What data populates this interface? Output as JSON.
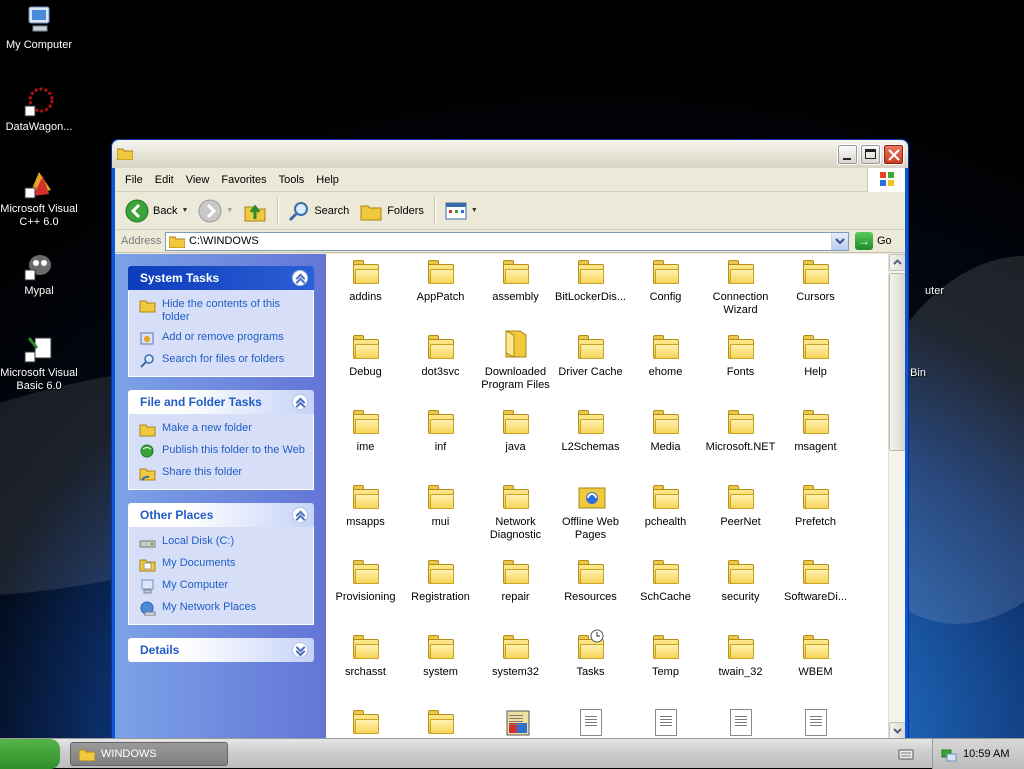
{
  "desktop": {
    "icons": [
      {
        "label": "My Computer"
      },
      {
        "label": "DataWagon..."
      },
      {
        "label": "Microsoft Visual C++ 6.0"
      },
      {
        "label": "Mypal"
      },
      {
        "label": "Microsoft Visual Basic 6.0"
      }
    ],
    "partial_right_labels": [
      "uter",
      "Bin"
    ]
  },
  "window": {
    "menu": [
      "File",
      "Edit",
      "View",
      "Favorites",
      "Tools",
      "Help"
    ],
    "toolbar": {
      "back": "Back",
      "search": "Search",
      "folders": "Folders"
    },
    "address": {
      "label": "Address",
      "value": "C:\\WINDOWS",
      "go": "Go"
    },
    "taskpane": {
      "system_tasks": {
        "title": "System Tasks",
        "links": [
          "Hide the contents of this folder",
          "Add or remove programs",
          "Search for files or folders"
        ]
      },
      "file_folder_tasks": {
        "title": "File and Folder Tasks",
        "links": [
          "Make a new folder",
          "Publish this folder to the Web",
          "Share this folder"
        ]
      },
      "other_places": {
        "title": "Other Places",
        "links": [
          "Local Disk (C:)",
          "My Documents",
          "My Computer",
          "My Network Places"
        ]
      },
      "details": {
        "title": "Details"
      }
    },
    "folders": [
      "addins",
      "AppPatch",
      "assembly",
      "BitLockerDis...",
      "Config",
      "Connection Wizard",
      "Cursors",
      "Debug",
      "dot3svc",
      "Downloaded Program Files",
      "Driver Cache",
      "ehome",
      "Fonts",
      "Help",
      "ime",
      "inf",
      "java",
      "L2Schemas",
      "Media",
      "Microsoft.NET",
      "msagent",
      "msapps",
      "mui",
      "Network Diagnostic",
      "Offline Web Pages",
      "pchealth",
      "PeerNet",
      "Prefetch",
      "Provisioning",
      "Registration",
      "repair",
      "Resources",
      "SchCache",
      "security",
      "SoftwareDi...",
      "srchasst",
      "system",
      "system32",
      "Tasks",
      "Temp",
      "twain_32",
      "WBEM"
    ]
  },
  "taskbar": {
    "window_button": "WINDOWS",
    "clock": "10:59 AM"
  },
  "colors": {
    "xp_blue": "#0a58d8",
    "taskpane_link": "#215dc6",
    "folder_yellow": "#f1c93c"
  }
}
